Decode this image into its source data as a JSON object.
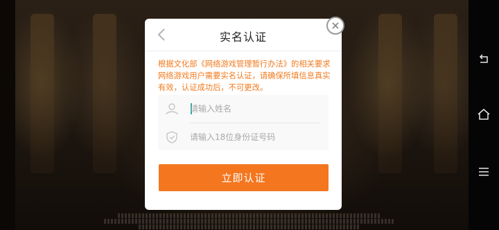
{
  "dialog": {
    "title": "实名认证",
    "notice": "根据文化部《网络游戏管理暂行办法》的相关要求网络游戏用户需要实名认证，请确保所填信息真实有效，认证成功后，不可更改。",
    "name_field": {
      "placeholder": "请输入姓名",
      "value": "",
      "icon": "user-icon"
    },
    "id_field": {
      "placeholder": "请输入18位身份证号码",
      "value": "",
      "icon": "shield-check-icon"
    },
    "submit_label": "立即认证",
    "back_icon": "chevron-left-icon",
    "close_icon": "close-icon"
  },
  "system_nav": {
    "back_icon": "back-nav-icon",
    "home_icon": "home-nav-icon",
    "menu_icon": "menu-nav-icon"
  },
  "colors": {
    "accent": "#f4761f",
    "notice_text": "#f07a1e",
    "caret": "#2aa7a0"
  }
}
